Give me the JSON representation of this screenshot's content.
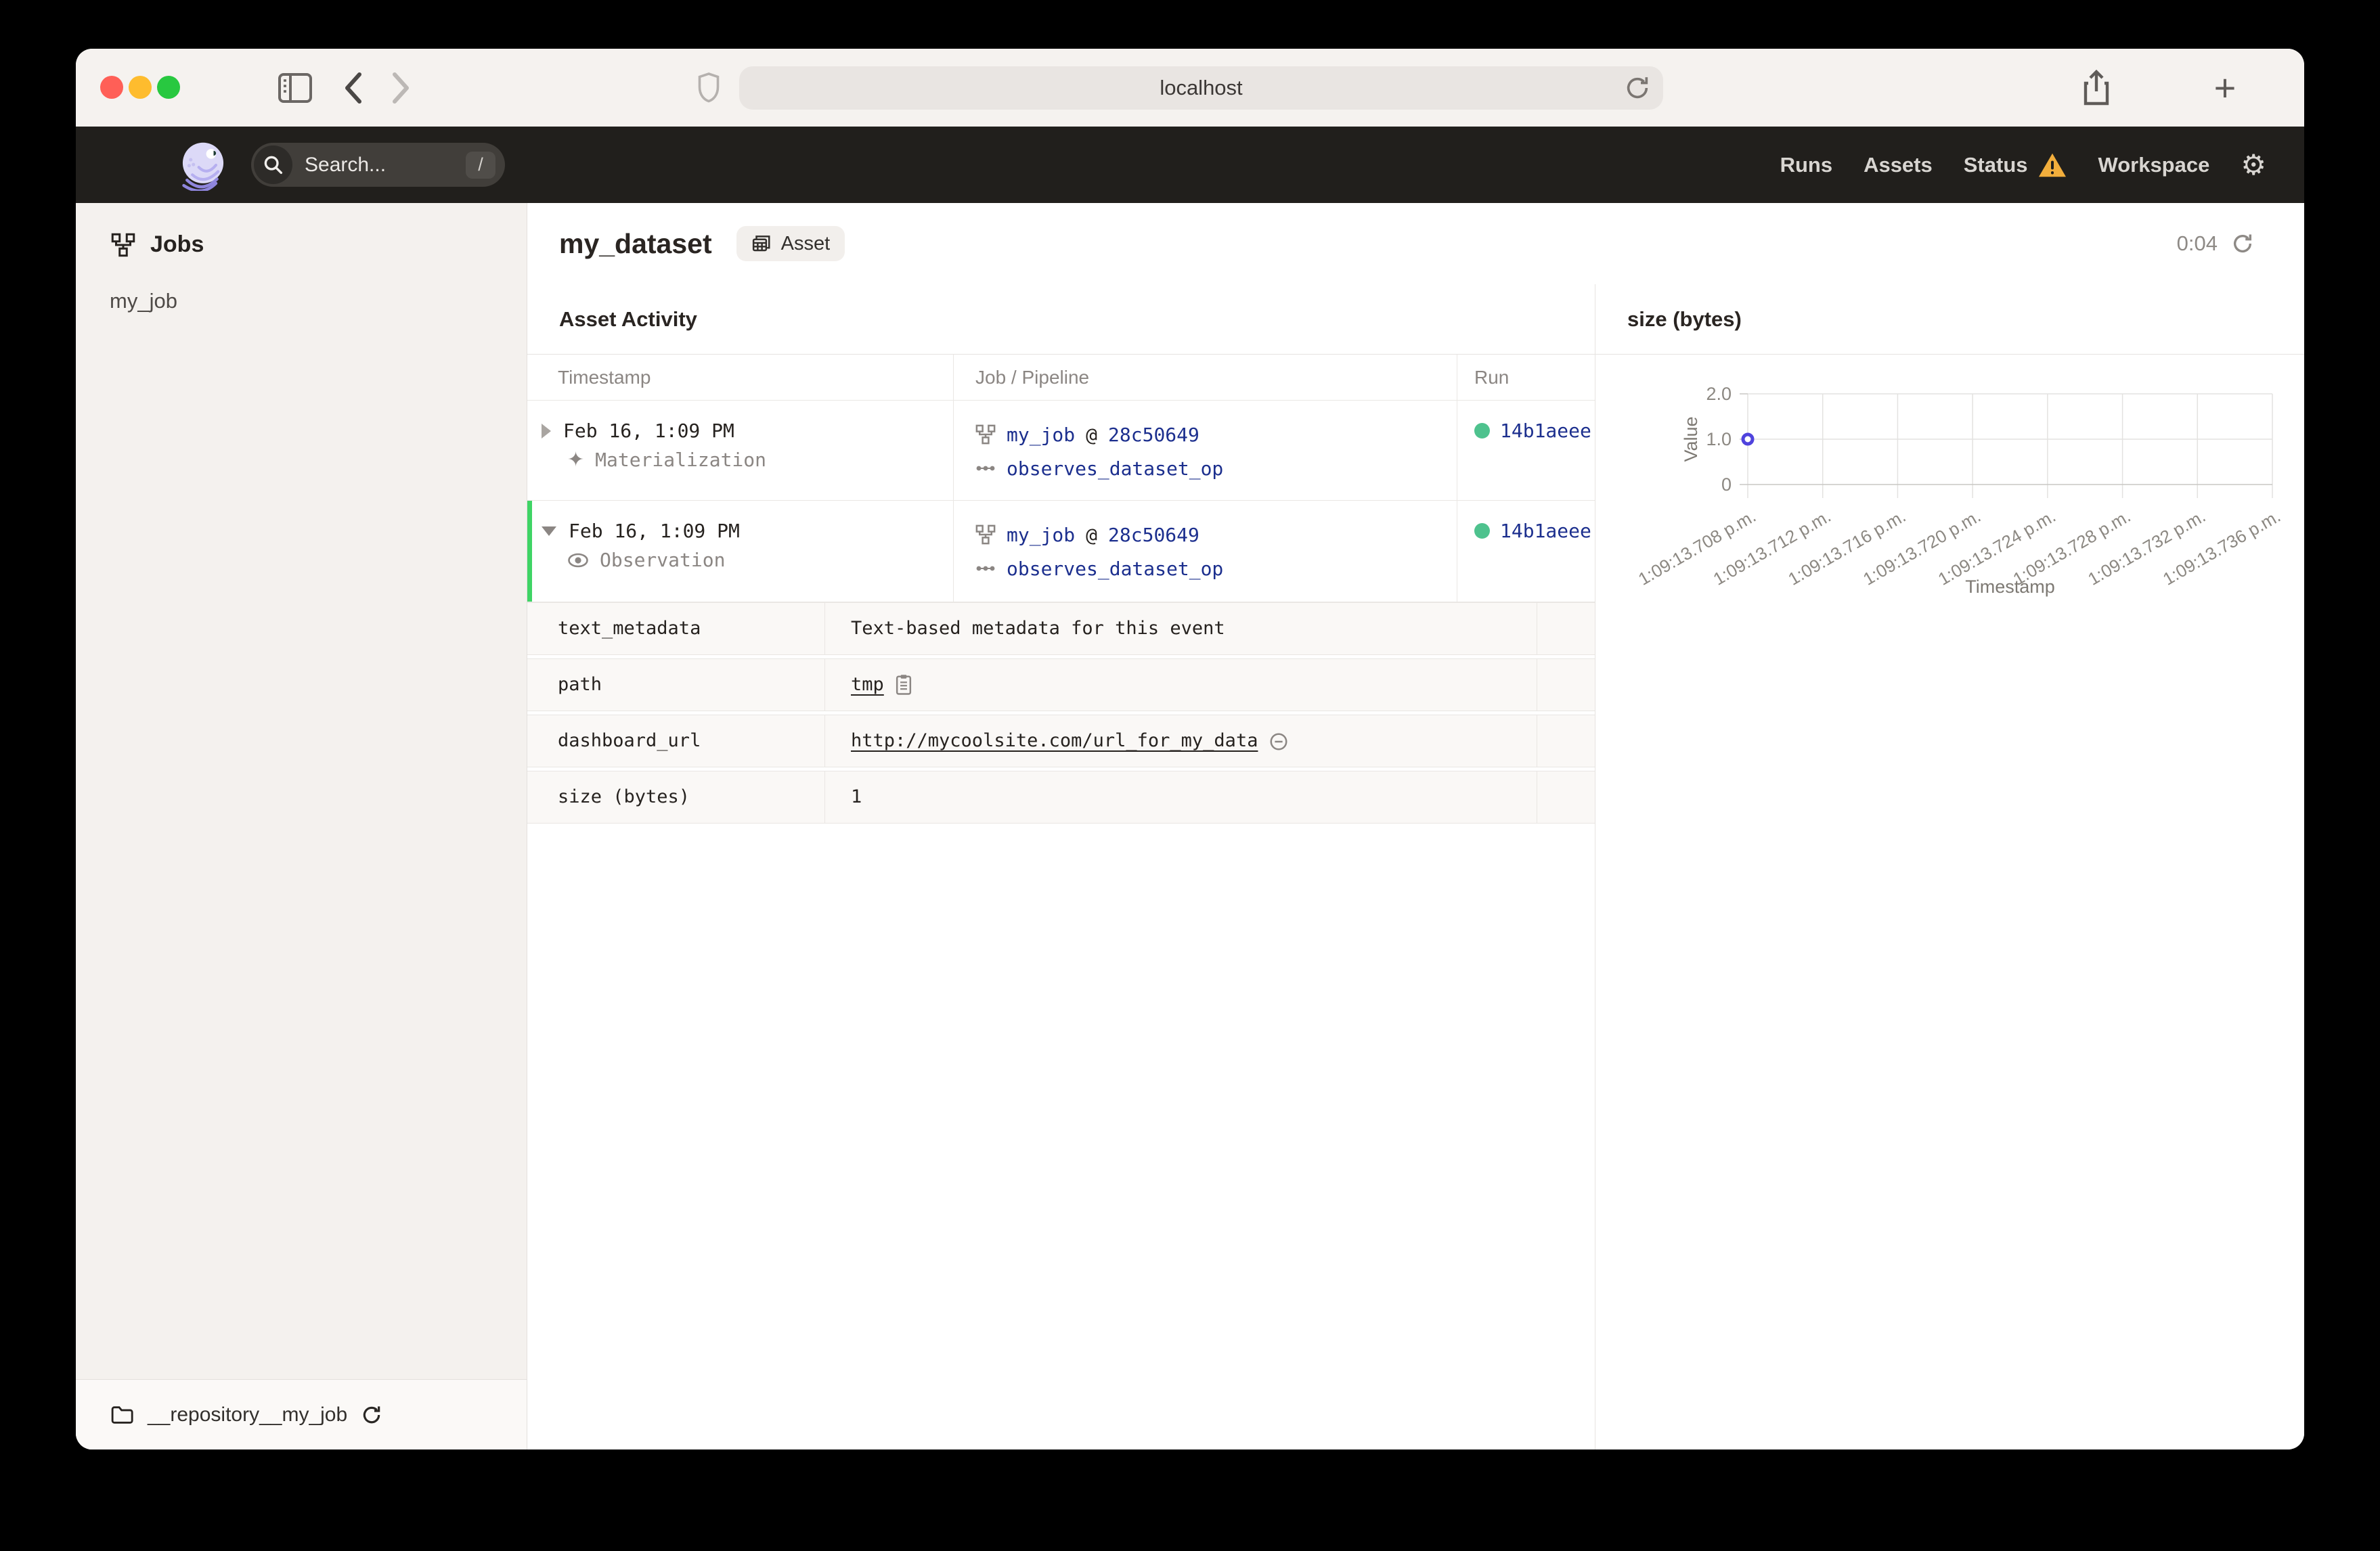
{
  "browser": {
    "url": "localhost"
  },
  "nav": {
    "search_placeholder": "Search...",
    "search_shortcut": "/",
    "links": {
      "runs": "Runs",
      "assets": "Assets",
      "status": "Status",
      "workspace": "Workspace"
    }
  },
  "icons": {
    "gear": "⚙",
    "sparkle": "✦",
    "plus": "+"
  },
  "sidebar": {
    "title": "Jobs",
    "items": [
      {
        "label": "my_job"
      }
    ],
    "footer": {
      "repository": "__repository__my_job"
    }
  },
  "main": {
    "title": "my_dataset",
    "badge": "Asset",
    "refresh_timer": "0:04",
    "section_title": "Asset Activity",
    "table": {
      "columns": [
        "Timestamp",
        "Job / Pipeline",
        "Run"
      ],
      "at_separator": "@",
      "rows": [
        {
          "timestamp": "Feb 16, 1:09 PM",
          "event_type": "Materialization",
          "job": "my_job",
          "run_tag": "28c50649",
          "op": "observes_dataset_op",
          "run_id": "14b1aeee"
        },
        {
          "timestamp": "Feb 16, 1:09 PM",
          "event_type": "Observation",
          "job": "my_job",
          "run_tag": "28c50649",
          "op": "observes_dataset_op",
          "run_id": "14b1aeee"
        }
      ]
    },
    "metadata": {
      "rows": [
        {
          "key": "text_metadata",
          "value": "Text-based metadata for this event"
        },
        {
          "key": "path",
          "value": "tmp"
        },
        {
          "key": "dashboard_url",
          "value": "http://mycoolsite.com/url_for_my_data"
        },
        {
          "key": "size (bytes)",
          "value": "1"
        }
      ]
    }
  },
  "chart": {
    "title": "size (bytes)"
  },
  "chart_data": {
    "type": "scatter",
    "title": "size (bytes)",
    "xlabel": "Timestamp",
    "ylabel": "Value",
    "ylim": [
      0,
      2
    ],
    "yticks": [
      0,
      1,
      2
    ],
    "ytick_labels": [
      "0",
      "1.0",
      "2.0"
    ],
    "x_tick_labels": [
      "1:09:13.708 p.m.",
      "1:09:13.712 p.m.",
      "1:09:13.716 p.m.",
      "1:09:13.720 p.m.",
      "1:09:13.724 p.m.",
      "1:09:13.728 p.m.",
      "1:09:13.732 p.m.",
      "1:09:13.736 p.m."
    ],
    "points": [
      {
        "x_index": 0,
        "x_label": "1:09:13.708 p.m.",
        "y": 1
      }
    ],
    "point_color": "#4F43DD",
    "grid": true,
    "legend": "none"
  },
  "colors": {
    "nav_bg": "#211f1c",
    "link_blue": "#1c2f8e",
    "run_green": "#4ec28e",
    "expanded_green": "#3fd465",
    "warning_yellow": "#f2ae3c",
    "point_indigo": "#4F43DD"
  }
}
